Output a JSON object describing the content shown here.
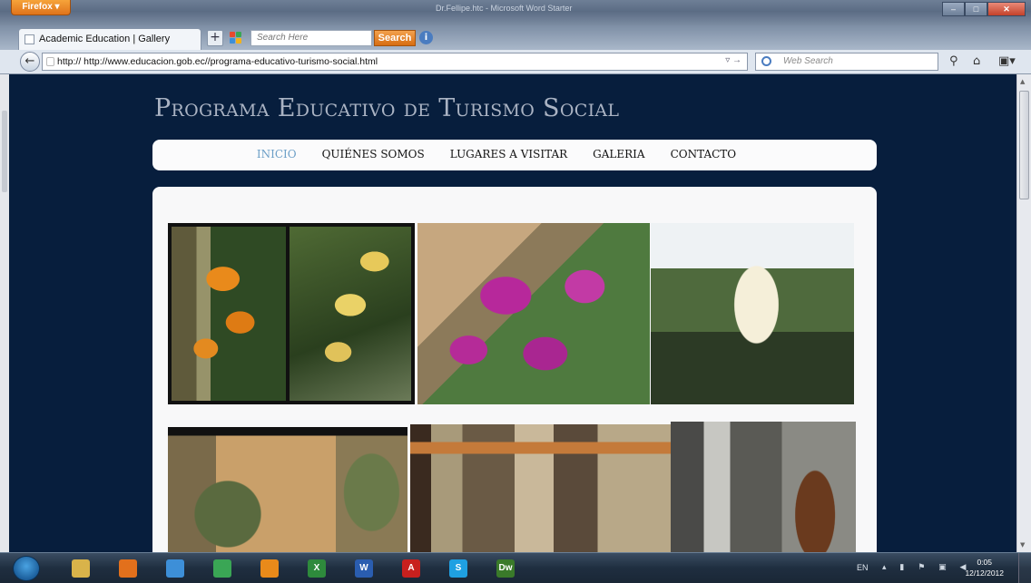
{
  "browser": {
    "menu_label": "Firefox ▾",
    "window_title": "Dr.Fellipe.htc - Microsoft Word Starter",
    "tab_title": "Academic Education | Gallery",
    "new_tab": "+",
    "toolbar_search_placeholder": "Search Here",
    "toolbar_search_button": "Search",
    "url": "http:// http://www.educacion.gob.ec//programa-educativo-turismo-social.html",
    "web_search_placeholder": "Web Search"
  },
  "site": {
    "title": "Programa Educativo de Turismo Social",
    "nav": [
      {
        "label": "Inicio",
        "active": true
      },
      {
        "label": "Quiénes Somos",
        "active": false
      },
      {
        "label": "Lugares a Visitar",
        "active": false
      },
      {
        "label": "Galeria",
        "active": false
      },
      {
        "label": "Contacto",
        "active": false
      }
    ],
    "gallery": [
      {
        "subject": "orange and yellow orchids"
      },
      {
        "subject": "magenta orchids"
      },
      {
        "subject": "white orchid"
      },
      {
        "subject": "church facade with trees"
      },
      {
        "subject": "museum glass display cases"
      },
      {
        "subject": "wooden carved figure"
      }
    ]
  },
  "taskbar": {
    "apps": [
      {
        "name": "file-explorer-icon",
        "color": "#d9b34a",
        "glyph": ""
      },
      {
        "name": "firefox-icon",
        "color": "#e2701c",
        "glyph": ""
      },
      {
        "name": "network-icon",
        "color": "#3d8fd8",
        "glyph": ""
      },
      {
        "name": "chrome-icon",
        "color": "#3aa655",
        "glyph": ""
      },
      {
        "name": "media-player-icon",
        "color": "#e98a1a",
        "glyph": ""
      },
      {
        "name": "excel-icon",
        "color": "#2e8a3c",
        "glyph": "X"
      },
      {
        "name": "word-icon",
        "color": "#2a5db0",
        "glyph": "W"
      },
      {
        "name": "acrobat-icon",
        "color": "#c8201e",
        "glyph": "A"
      },
      {
        "name": "skype-icon",
        "color": "#1fa0e2",
        "glyph": "S"
      },
      {
        "name": "dreamweaver-icon",
        "color": "#3a7a2a",
        "glyph": "Dw"
      }
    ],
    "language": "EN",
    "time": "0:05",
    "date": "12/12/2012"
  }
}
